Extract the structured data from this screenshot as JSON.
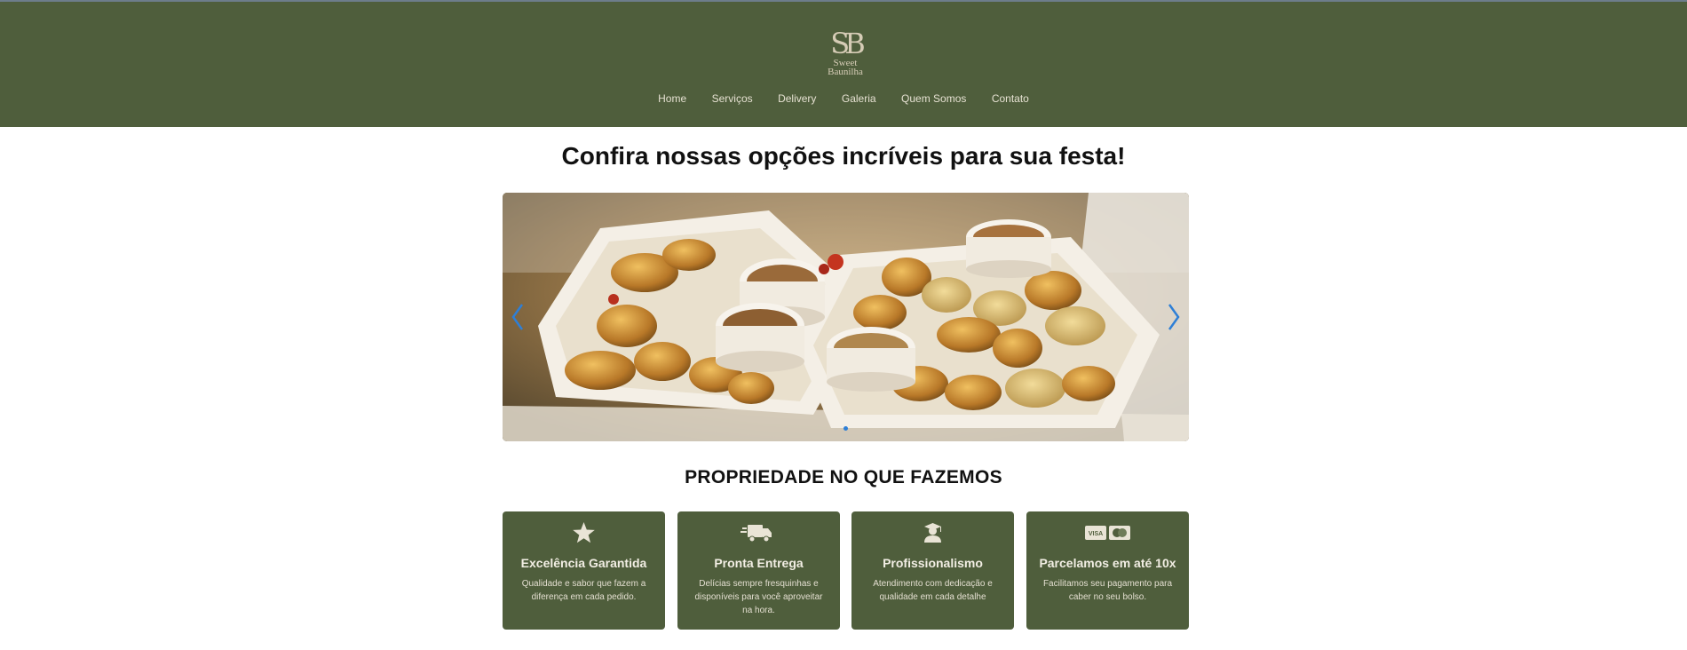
{
  "brand": {
    "monogram": "SB",
    "line1": "Sweet",
    "line2": "Baunilha"
  },
  "nav": {
    "items": [
      {
        "label": "Home"
      },
      {
        "label": "Serviços"
      },
      {
        "label": "Delivery"
      },
      {
        "label": "Galeria"
      },
      {
        "label": "Quem Somos"
      },
      {
        "label": "Contato"
      }
    ]
  },
  "hero": {
    "title": "Confira nossas opções incríveis para sua festa!"
  },
  "carousel": {
    "slide_count": 1,
    "active_index": 0
  },
  "features": {
    "heading": "PROPRIEDADE NO QUE FAZEMOS",
    "cards": [
      {
        "icon": "star-icon",
        "title": "Excelência Garantida",
        "text": "Qualidade e sabor que fazem a diferença em cada pedido."
      },
      {
        "icon": "delivery-truck-icon",
        "title": "Pronta Entrega",
        "text": "Delícias sempre fresquinhas e disponíveis para você aproveitar na hora."
      },
      {
        "icon": "graduate-icon",
        "title": "Profissionalismo",
        "text": "Atendimento com dedicação e qualidade em cada detalhe"
      },
      {
        "icon": "payment-cards-icon",
        "title": "Parcelamos em até 10x",
        "text": "Facilitamos seu pagamento para caber no seu bolso."
      }
    ]
  },
  "colors": {
    "header_bg": "#4f5e3c",
    "card_bg": "#4f5e3c",
    "accent_blue": "#2e7fd6",
    "brand_text": "#d6ccb6"
  }
}
